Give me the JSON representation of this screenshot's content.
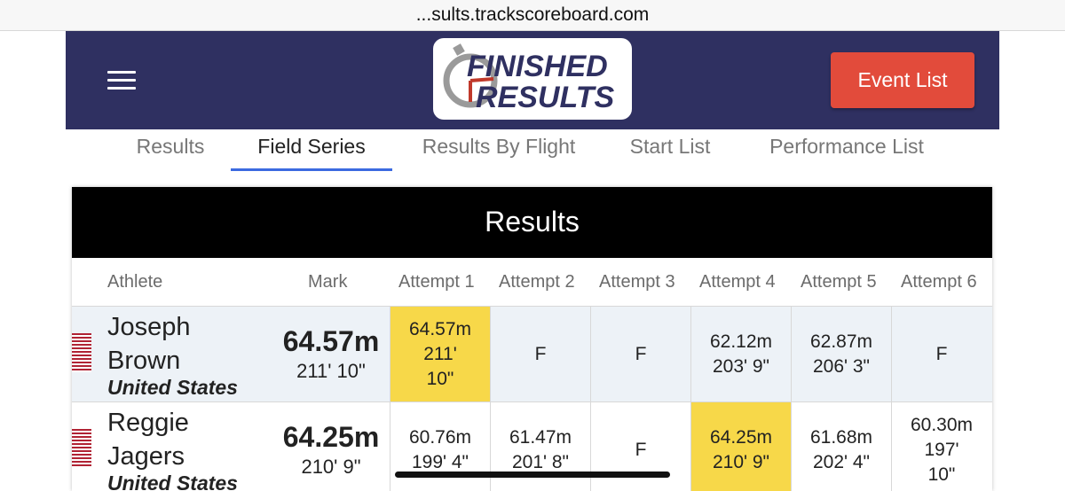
{
  "browser": {
    "url": "...sults.trackscoreboard.com"
  },
  "header": {
    "logo_line1": "FINISHED",
    "logo_line2": "RESULTS",
    "event_list_label": "Event List"
  },
  "tabs": [
    {
      "label": "Results"
    },
    {
      "label": "Field Series"
    },
    {
      "label": "Results By Flight"
    },
    {
      "label": "Start List"
    },
    {
      "label": "Performance List"
    }
  ],
  "active_tab": "Field Series",
  "table": {
    "title": "Results",
    "columns": [
      "Athlete",
      "Mark",
      "Attempt 1",
      "Attempt 2",
      "Attempt 3",
      "Attempt 4",
      "Attempt 5",
      "Attempt 6"
    ],
    "rows": [
      {
        "first_name": "Joseph",
        "last_name": "Brown",
        "country": "United States",
        "mark_m": "64.57m",
        "mark_ft": "211' 10\"",
        "attempts": [
          {
            "line1": "64.57m",
            "line2": "211'",
            "line3": "10\"",
            "best": true
          },
          {
            "line1": "F",
            "line2": "",
            "line3": "",
            "best": false
          },
          {
            "line1": "F",
            "line2": "",
            "line3": "",
            "best": false
          },
          {
            "line1": "62.12m",
            "line2": "203' 9\"",
            "line3": "",
            "best": false
          },
          {
            "line1": "62.87m",
            "line2": "206' 3\"",
            "line3": "",
            "best": false
          },
          {
            "line1": "F",
            "line2": "",
            "line3": "",
            "best": false
          }
        ]
      },
      {
        "first_name": "Reggie",
        "last_name": "Jagers",
        "country": "United States",
        "mark_m": "64.25m",
        "mark_ft": "210' 9\"",
        "attempts": [
          {
            "line1": "60.76m",
            "line2": "199' 4\"",
            "line3": "",
            "best": false
          },
          {
            "line1": "61.47m",
            "line2": "201' 8\"",
            "line3": "",
            "best": false
          },
          {
            "line1": "F",
            "line2": "",
            "line3": "",
            "best": false
          },
          {
            "line1": "64.25m",
            "line2": "210' 9\"",
            "line3": "",
            "best": true
          },
          {
            "line1": "61.68m",
            "line2": "202' 4\"",
            "line3": "",
            "best": false
          },
          {
            "line1": "60.30m",
            "line2": "197'",
            "line3": "10\"",
            "best": false
          }
        ]
      }
    ]
  },
  "colors": {
    "header_bg": "#2f3061",
    "event_button_bg": "#e24b3b",
    "active_tab_underline": "#3c6ae0",
    "best_attempt_bg": "#f7d849",
    "row_alt_bg": "#edf2f7"
  },
  "icons": {
    "menu": "hamburger-menu-icon",
    "flag": "us-flag-icon"
  }
}
